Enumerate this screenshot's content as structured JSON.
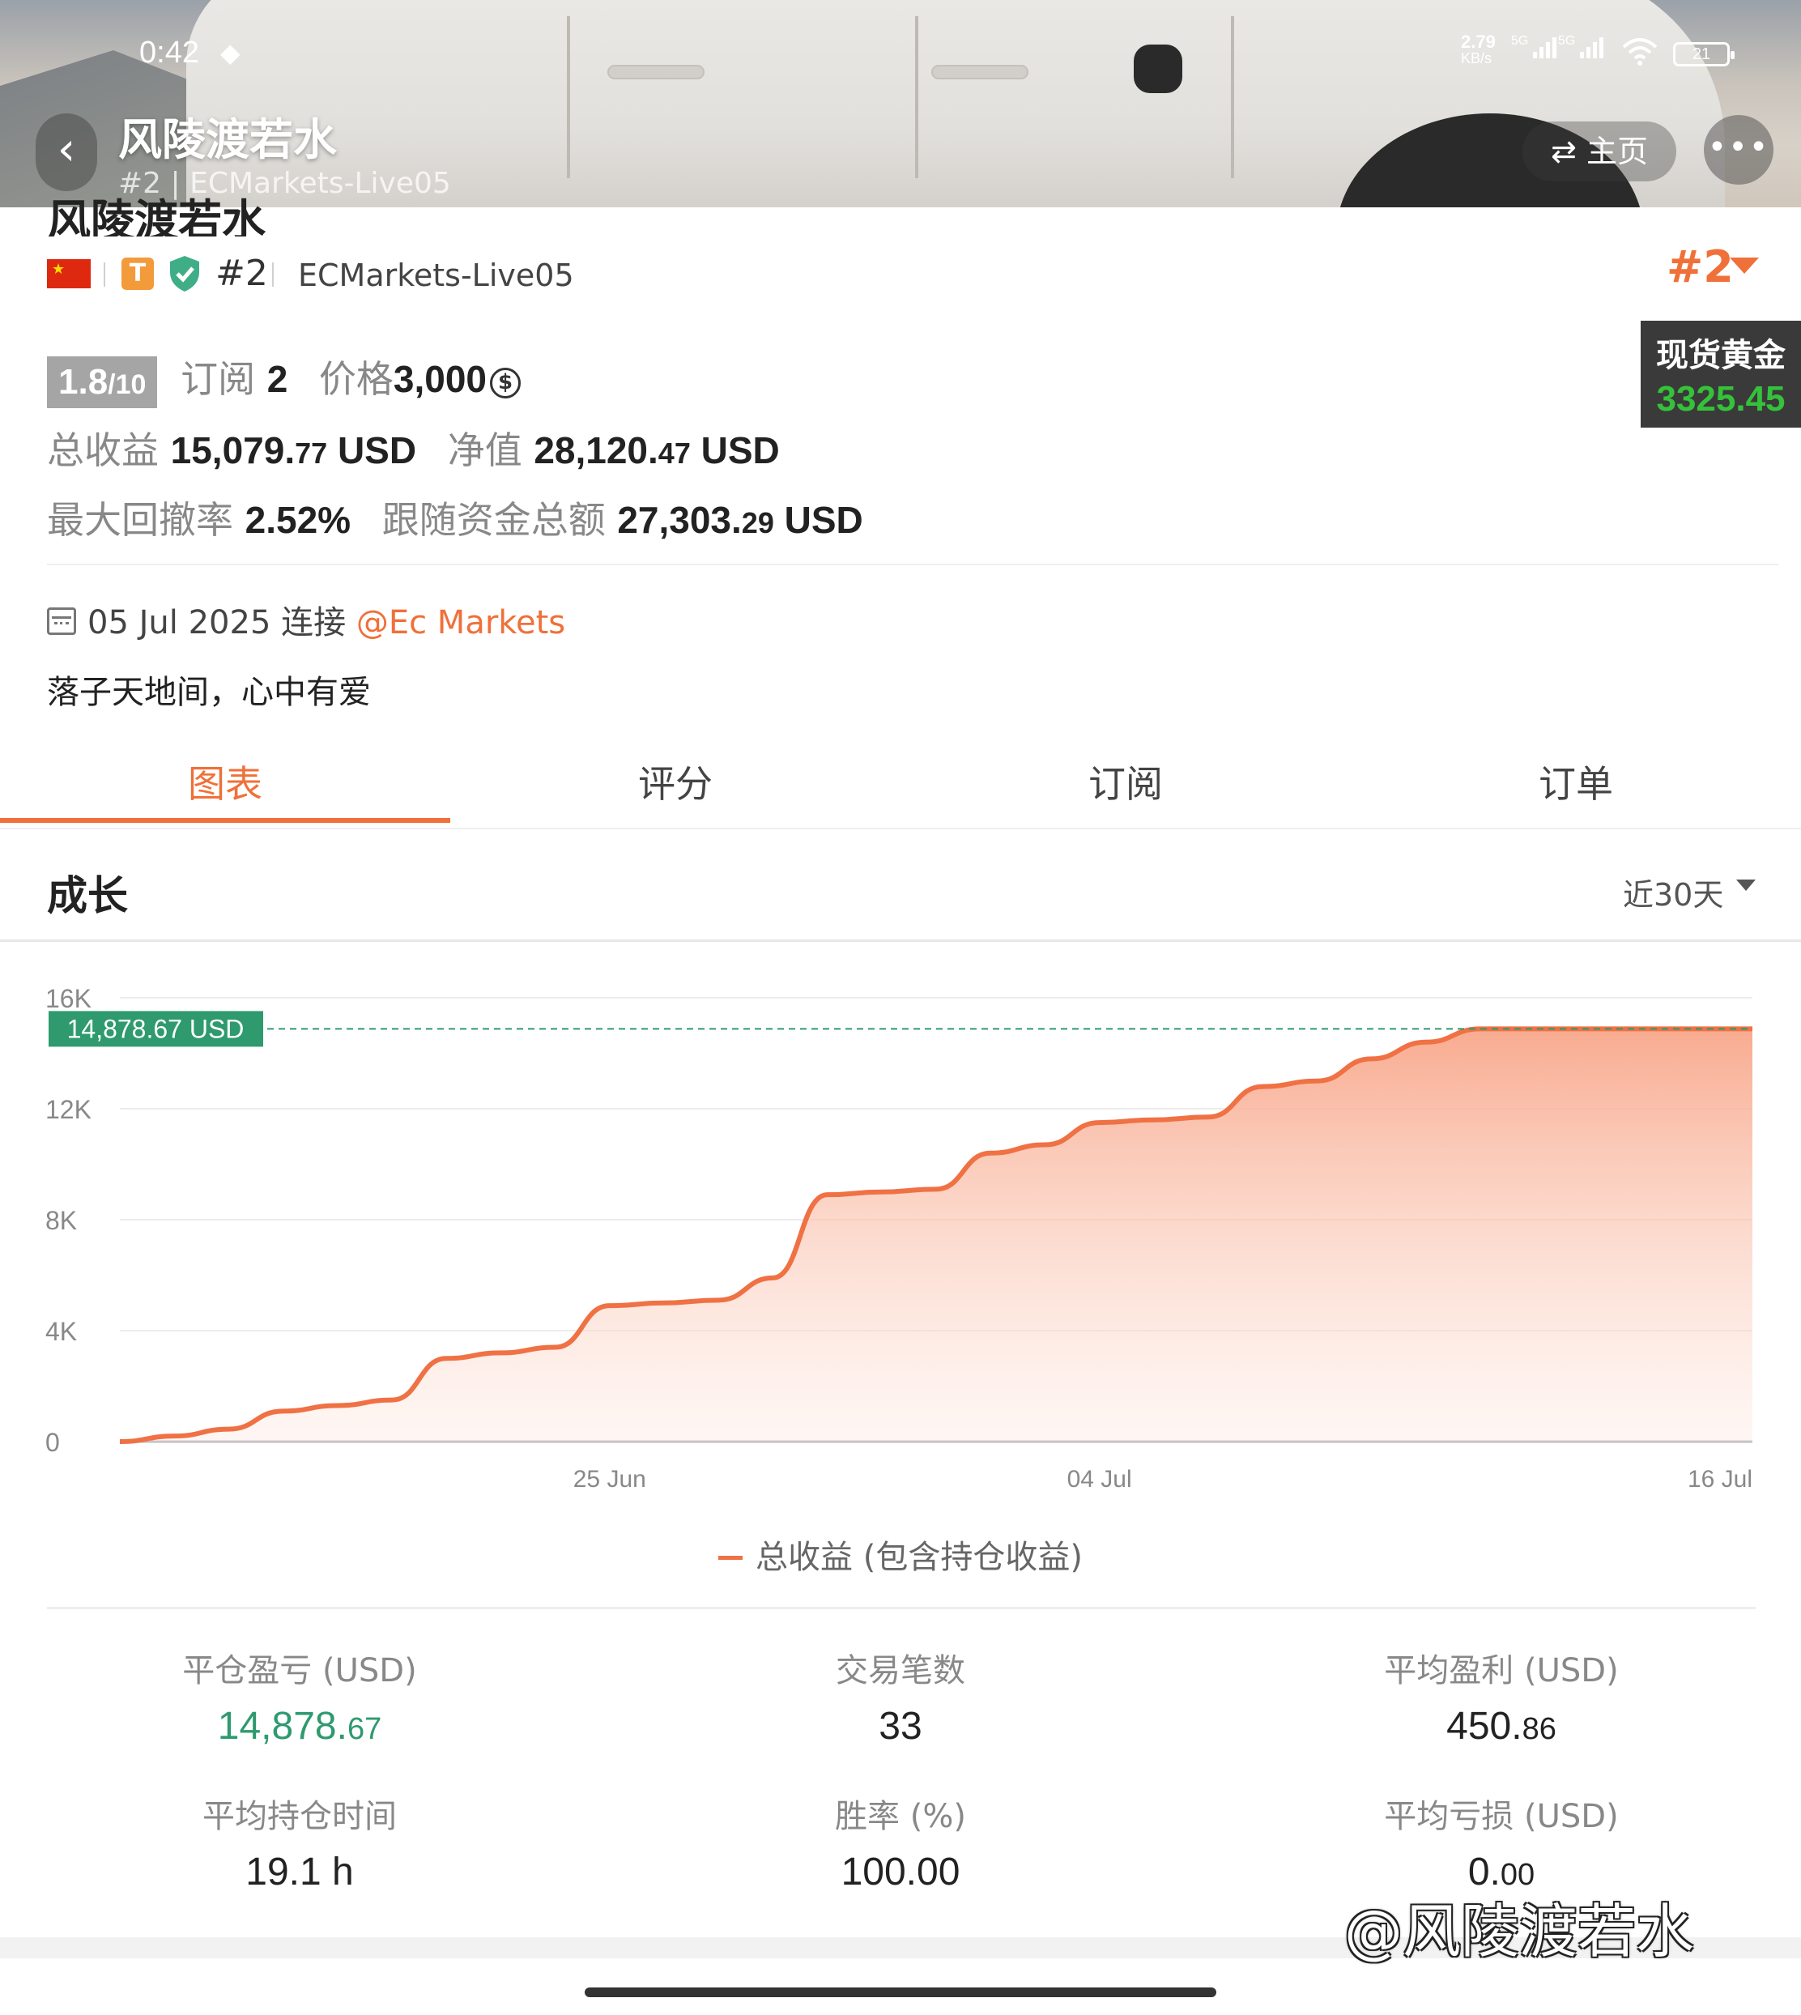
{
  "status_bar": {
    "time": "0:42",
    "net_speed": "2.79",
    "net_unit": "KB/s",
    "signal_label_1": "5G",
    "signal_label_2": "5G",
    "battery": "21"
  },
  "header": {
    "title": "风陵渡若水",
    "subtitle": "#2 | ECMarkets-Live05",
    "home_label": "主页",
    "more_label": "•••"
  },
  "profile": {
    "name": "风陵渡若水",
    "badge_letter": "T",
    "rank": "#2",
    "server": "ECMarkets-Live05",
    "rank_big": "#2",
    "score": "1.8",
    "score_max": "/10",
    "subscribe_label": "订阅",
    "subscribe_count": "2",
    "price_label": "价格",
    "price_value": "3,000",
    "total_profit_label": "总收益",
    "total_profit_int": "15,079.",
    "total_profit_dec": "77",
    "total_profit_unit": "USD",
    "equity_label": "净值",
    "equity_int": "28,120.",
    "equity_dec": "47",
    "equity_unit": "USD",
    "drawdown_label": "最大回撤率",
    "drawdown_value": "2.52%",
    "follow_label": "跟随资金总额",
    "follow_int": "27,303.",
    "follow_dec": "29",
    "follow_unit": "USD",
    "connect_date": "05 Jul 2025 连接",
    "connect_broker": "@Ec Markets",
    "motto": "落子天地间，心中有爱"
  },
  "gold_widget": {
    "label": "现货黄金",
    "price": "3325.45"
  },
  "tabs": [
    "图表",
    "评分",
    "订阅",
    "订单"
  ],
  "growth": {
    "title": "成长",
    "range": "近30天"
  },
  "chart_data": {
    "type": "area",
    "x": [
      "2025-06-16",
      "2025-06-17",
      "2025-06-18",
      "2025-06-19",
      "2025-06-20",
      "2025-06-21",
      "2025-06-22",
      "2025-06-23",
      "2025-06-24",
      "2025-06-25",
      "2025-06-26",
      "2025-06-27",
      "2025-06-28",
      "2025-06-29",
      "2025-06-30",
      "2025-07-01",
      "2025-07-02",
      "2025-07-03",
      "2025-07-04",
      "2025-07-05",
      "2025-07-06",
      "2025-07-07",
      "2025-07-08",
      "2025-07-09",
      "2025-07-10",
      "2025-07-11",
      "2025-07-12",
      "2025-07-13",
      "2025-07-14",
      "2025-07-15",
      "2025-07-16"
    ],
    "series": [
      {
        "name": "总收益 (包含持仓收益)",
        "values": [
          0,
          200,
          450,
          1100,
          1300,
          1500,
          3000,
          3200,
          3400,
          4900,
          5000,
          5100,
          5900,
          8900,
          9000,
          9100,
          10400,
          10700,
          11500,
          11600,
          11700,
          12800,
          13000,
          13800,
          14400,
          14878.67,
          14878.67,
          14878.67,
          14878.67,
          14878.67,
          14878.67
        ]
      }
    ],
    "x_tick_labels": [
      "25 Jun",
      "04 Jul",
      "16 Jul"
    ],
    "y_tick_labels": [
      "0",
      "4K",
      "8K",
      "12K",
      "16K"
    ],
    "ylim": [
      0,
      16000
    ],
    "xlim": [
      "2025-06-16",
      "2025-07-16"
    ],
    "current_value_label": "14,878.67 USD",
    "current_value": 14878.67,
    "grid": true,
    "legend": "bottom-center",
    "line_color": "#ef7144",
    "fill_color": "#f9b69e",
    "marker_color": "#2e9a6e"
  },
  "stats": [
    {
      "label": "平仓盈亏 (USD)",
      "value_int": "14,878.",
      "value_dec": "67",
      "highlight": true
    },
    {
      "label": "交易笔数",
      "value_int": "33",
      "value_dec": "",
      "highlight": false
    },
    {
      "label": "平均盈利 (USD)",
      "value_int": "450.",
      "value_dec": "86",
      "highlight": false
    },
    {
      "label": "平均持仓时间",
      "value_int": "19.1 h",
      "value_dec": "",
      "highlight": false
    },
    {
      "label": "胜率 (%)",
      "value_int": "100.00",
      "value_dec": "",
      "highlight": false
    },
    {
      "label": "平均亏损 (USD)",
      "value_int": "0.",
      "value_dec": "00",
      "highlight": false
    }
  ],
  "watermark": "@风陵渡若水",
  "colors": {
    "accent": "#f0703a",
    "positive": "#2e9a6e",
    "gold_price": "#35c23a"
  }
}
